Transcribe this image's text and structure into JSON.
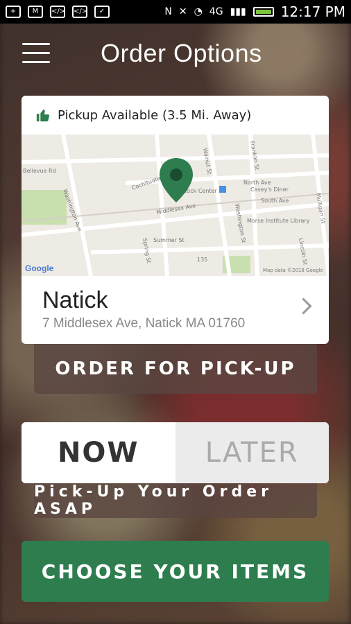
{
  "status_bar": {
    "network": "4G",
    "time": "12:17 PM",
    "colors": {
      "battery": "#7ec33f"
    }
  },
  "header": {
    "title": "Order Options"
  },
  "location": {
    "availability": "Pickup Available (3.5 Mi. Away)",
    "store_name": "Natick",
    "address": "7 Middlesex Ave, Natick MA 01760",
    "map": {
      "streets": [
        "Bellevue Rd",
        "Washington Ave",
        "Cochituate St",
        "Walnut St",
        "Franklin St",
        "North Ave",
        "Middlesex Ave",
        "South Ave",
        "Washington St",
        "Summer St",
        "Spring St",
        "Mulligan St",
        "Lincoln St"
      ],
      "places": [
        "Natick Center",
        "Casey's Diner",
        "Morse Institute Library"
      ],
      "route": "135",
      "google_label": "Google",
      "credit": "Map data ©2018 Google"
    },
    "colors": {
      "pin": "#2e7d4f"
    }
  },
  "buttons": {
    "pickup": "ORDER FOR PICK-UP",
    "now": "NOW",
    "later": "LATER",
    "asap_note": "Pick-Up Your Order ASAP",
    "choose": "CHOOSE YOUR ITEMS",
    "colors": {
      "primary": "#2e7d4f"
    }
  }
}
